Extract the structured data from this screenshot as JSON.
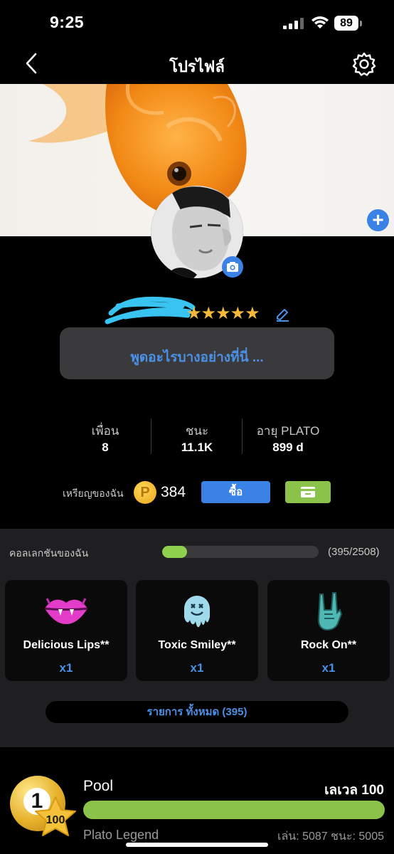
{
  "status_bar": {
    "time": "9:25",
    "battery": "89"
  },
  "header": {
    "title": "โปรไฟล์"
  },
  "profile": {
    "rating_stars": "★★★★★",
    "bio_placeholder": "พูดอะไรบางอย่างที่นี่ ..."
  },
  "stats": [
    {
      "label": "เพื่อน",
      "value": "8"
    },
    {
      "label": "ชนะ",
      "value": "11.1K"
    },
    {
      "label": "อายุ PLATO",
      "value": "899 d"
    }
  ],
  "coins": {
    "label": "เหรียญของฉัน",
    "icon_letter": "P",
    "value": "384",
    "buy_label": "ซื้อ"
  },
  "collection": {
    "title": "คอลเลกชันของฉัน",
    "count": "(395/2508)",
    "progress": 0.157,
    "items": [
      {
        "name": "Delicious Lips**",
        "qty": "x1",
        "icon": "lips-icon"
      },
      {
        "name": "Toxic Smiley**",
        "qty": "x1",
        "icon": "smiley-icon"
      },
      {
        "name": "Rock On**",
        "qty": "x1",
        "icon": "rock-hand-icon"
      }
    ],
    "all_items_label": "รายการ ทั้งหมด (395)"
  },
  "game": {
    "ball_number": "1",
    "star_level": "100",
    "name": "Pool",
    "level_text": "เลเวล 100",
    "progress": 1.0,
    "rank": "Plato Legend",
    "stats_text": "เล่น: 5087 ชนะ: 5005"
  },
  "colors": {
    "accent_blue": "#3b82e6",
    "link_blue": "#4a90e6",
    "green": "#8bc34a",
    "star_gold": "#f4b93a"
  }
}
